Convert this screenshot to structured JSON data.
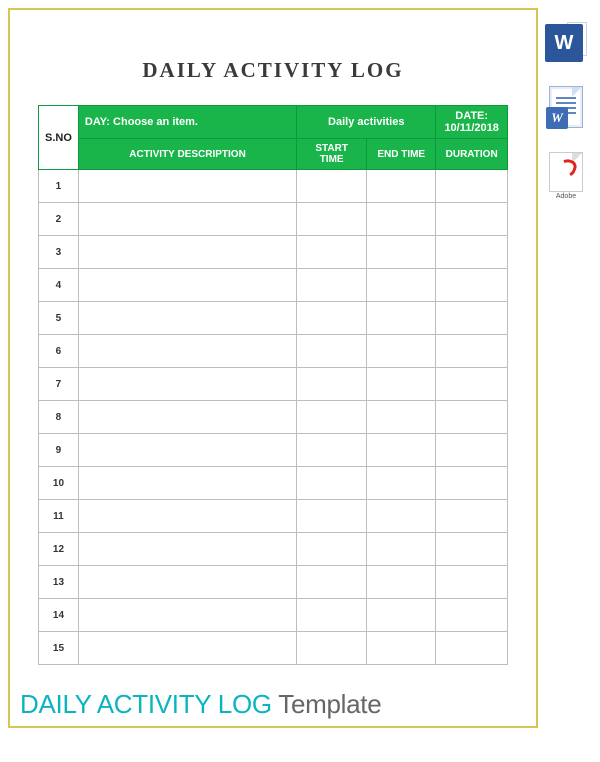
{
  "title": "DAILY ACTIVITY LOG",
  "subtitle_main": "DAILY ACTIVITY LOG",
  "subtitle_suffix": " Template",
  "header": {
    "sno": "S.NO",
    "day_label": "DAY:",
    "day_value": "Choose an item.",
    "center": "Daily activities",
    "date_label": "DATE:",
    "date_value": "10/11/2018"
  },
  "columns": {
    "activity": "ACTIVITY DESCRIPTION",
    "start": "START TIME",
    "end": "END TIME",
    "duration": "DURATION"
  },
  "rows": [
    {
      "sno": "1"
    },
    {
      "sno": "2"
    },
    {
      "sno": "3"
    },
    {
      "sno": "4"
    },
    {
      "sno": "5"
    },
    {
      "sno": "6"
    },
    {
      "sno": "7"
    },
    {
      "sno": "8"
    },
    {
      "sno": "9"
    },
    {
      "sno": "10"
    },
    {
      "sno": "11"
    },
    {
      "sno": "12"
    },
    {
      "sno": "13"
    },
    {
      "sno": "14"
    },
    {
      "sno": "15"
    }
  ],
  "icons": {
    "word": "W",
    "doc": "W",
    "pdf": "Adobe"
  }
}
